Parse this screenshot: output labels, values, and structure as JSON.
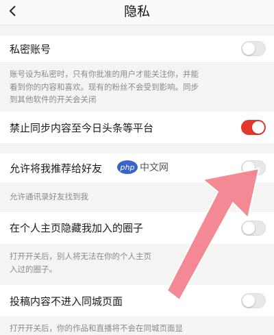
{
  "header": {
    "back_icon": "chevron-left-icon",
    "title": "隐私"
  },
  "settings": [
    {
      "label": "私密账号",
      "enabled": false,
      "description": [
        "账号设为私密时，只有你批准的用户才能关注你，并能",
        "看到你的内容和喜欢。现有的粉丝不会受到影响。同步",
        "到其他软件的开关会关闭"
      ]
    },
    {
      "label": "禁止同步内容至今日头条等平台",
      "enabled": true,
      "description": []
    },
    {
      "label": "允许将我推荐给好友",
      "enabled": false,
      "description": [
        "允许通讯录好友找到我"
      ]
    },
    {
      "label": "在个人主页隐藏我加入的圈子",
      "enabled": false,
      "description": [
        "打开开关后，别人将无法在你的个人主页",
        "入过的圈子。"
      ]
    },
    {
      "label": "投稿内容不进入同城页面",
      "enabled": false,
      "description": [
        "打开开关后，你的作品和直播将不会在同城页面显"
      ]
    }
  ],
  "watermark": {
    "logo": "php",
    "text": "中文网"
  },
  "colors": {
    "accent": "#e5362c",
    "arrow": "#f27a86"
  }
}
